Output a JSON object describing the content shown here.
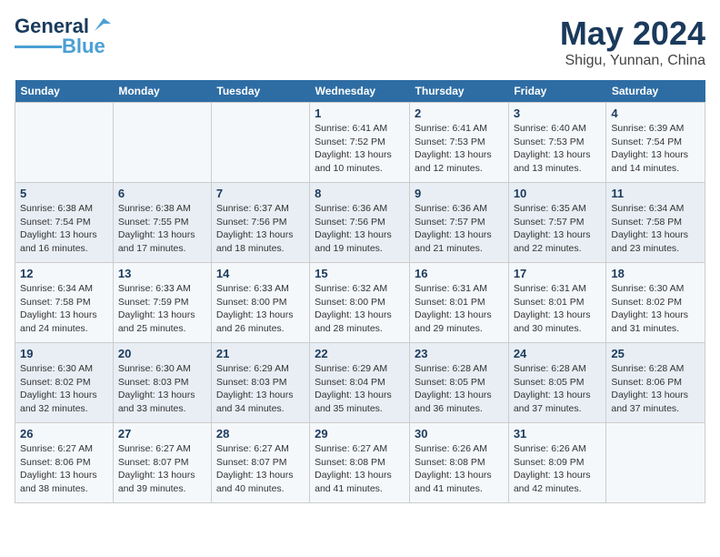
{
  "header": {
    "logo_line1": "General",
    "logo_line2": "Blue",
    "title": "May 2024",
    "location": "Shigu, Yunnan, China"
  },
  "weekdays": [
    "Sunday",
    "Monday",
    "Tuesday",
    "Wednesday",
    "Thursday",
    "Friday",
    "Saturday"
  ],
  "weeks": [
    [
      {
        "day": "",
        "info": ""
      },
      {
        "day": "",
        "info": ""
      },
      {
        "day": "",
        "info": ""
      },
      {
        "day": "1",
        "info": "Sunrise: 6:41 AM\nSunset: 7:52 PM\nDaylight: 13 hours\nand 10 minutes."
      },
      {
        "day": "2",
        "info": "Sunrise: 6:41 AM\nSunset: 7:53 PM\nDaylight: 13 hours\nand 12 minutes."
      },
      {
        "day": "3",
        "info": "Sunrise: 6:40 AM\nSunset: 7:53 PM\nDaylight: 13 hours\nand 13 minutes."
      },
      {
        "day": "4",
        "info": "Sunrise: 6:39 AM\nSunset: 7:54 PM\nDaylight: 13 hours\nand 14 minutes."
      }
    ],
    [
      {
        "day": "5",
        "info": "Sunrise: 6:38 AM\nSunset: 7:54 PM\nDaylight: 13 hours\nand 16 minutes."
      },
      {
        "day": "6",
        "info": "Sunrise: 6:38 AM\nSunset: 7:55 PM\nDaylight: 13 hours\nand 17 minutes."
      },
      {
        "day": "7",
        "info": "Sunrise: 6:37 AM\nSunset: 7:56 PM\nDaylight: 13 hours\nand 18 minutes."
      },
      {
        "day": "8",
        "info": "Sunrise: 6:36 AM\nSunset: 7:56 PM\nDaylight: 13 hours\nand 19 minutes."
      },
      {
        "day": "9",
        "info": "Sunrise: 6:36 AM\nSunset: 7:57 PM\nDaylight: 13 hours\nand 21 minutes."
      },
      {
        "day": "10",
        "info": "Sunrise: 6:35 AM\nSunset: 7:57 PM\nDaylight: 13 hours\nand 22 minutes."
      },
      {
        "day": "11",
        "info": "Sunrise: 6:34 AM\nSunset: 7:58 PM\nDaylight: 13 hours\nand 23 minutes."
      }
    ],
    [
      {
        "day": "12",
        "info": "Sunrise: 6:34 AM\nSunset: 7:58 PM\nDaylight: 13 hours\nand 24 minutes."
      },
      {
        "day": "13",
        "info": "Sunrise: 6:33 AM\nSunset: 7:59 PM\nDaylight: 13 hours\nand 25 minutes."
      },
      {
        "day": "14",
        "info": "Sunrise: 6:33 AM\nSunset: 8:00 PM\nDaylight: 13 hours\nand 26 minutes."
      },
      {
        "day": "15",
        "info": "Sunrise: 6:32 AM\nSunset: 8:00 PM\nDaylight: 13 hours\nand 28 minutes."
      },
      {
        "day": "16",
        "info": "Sunrise: 6:31 AM\nSunset: 8:01 PM\nDaylight: 13 hours\nand 29 minutes."
      },
      {
        "day": "17",
        "info": "Sunrise: 6:31 AM\nSunset: 8:01 PM\nDaylight: 13 hours\nand 30 minutes."
      },
      {
        "day": "18",
        "info": "Sunrise: 6:30 AM\nSunset: 8:02 PM\nDaylight: 13 hours\nand 31 minutes."
      }
    ],
    [
      {
        "day": "19",
        "info": "Sunrise: 6:30 AM\nSunset: 8:02 PM\nDaylight: 13 hours\nand 32 minutes."
      },
      {
        "day": "20",
        "info": "Sunrise: 6:30 AM\nSunset: 8:03 PM\nDaylight: 13 hours\nand 33 minutes."
      },
      {
        "day": "21",
        "info": "Sunrise: 6:29 AM\nSunset: 8:03 PM\nDaylight: 13 hours\nand 34 minutes."
      },
      {
        "day": "22",
        "info": "Sunrise: 6:29 AM\nSunset: 8:04 PM\nDaylight: 13 hours\nand 35 minutes."
      },
      {
        "day": "23",
        "info": "Sunrise: 6:28 AM\nSunset: 8:05 PM\nDaylight: 13 hours\nand 36 minutes."
      },
      {
        "day": "24",
        "info": "Sunrise: 6:28 AM\nSunset: 8:05 PM\nDaylight: 13 hours\nand 37 minutes."
      },
      {
        "day": "25",
        "info": "Sunrise: 6:28 AM\nSunset: 8:06 PM\nDaylight: 13 hours\nand 37 minutes."
      }
    ],
    [
      {
        "day": "26",
        "info": "Sunrise: 6:27 AM\nSunset: 8:06 PM\nDaylight: 13 hours\nand 38 minutes."
      },
      {
        "day": "27",
        "info": "Sunrise: 6:27 AM\nSunset: 8:07 PM\nDaylight: 13 hours\nand 39 minutes."
      },
      {
        "day": "28",
        "info": "Sunrise: 6:27 AM\nSunset: 8:07 PM\nDaylight: 13 hours\nand 40 minutes."
      },
      {
        "day": "29",
        "info": "Sunrise: 6:27 AM\nSunset: 8:08 PM\nDaylight: 13 hours\nand 41 minutes."
      },
      {
        "day": "30",
        "info": "Sunrise: 6:26 AM\nSunset: 8:08 PM\nDaylight: 13 hours\nand 41 minutes."
      },
      {
        "day": "31",
        "info": "Sunrise: 6:26 AM\nSunset: 8:09 PM\nDaylight: 13 hours\nand 42 minutes."
      },
      {
        "day": "",
        "info": ""
      }
    ]
  ]
}
